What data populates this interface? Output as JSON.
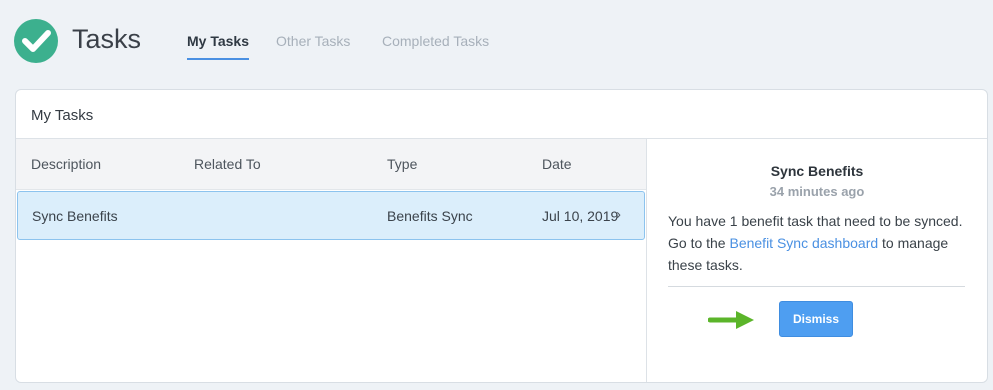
{
  "app": {
    "title": "Tasks",
    "logo_icon": "check-circle-icon",
    "accent": "#3cb08e"
  },
  "tabs": [
    {
      "label": "My Tasks",
      "active": true
    },
    {
      "label": "Other Tasks",
      "active": false
    },
    {
      "label": "Completed Tasks",
      "active": false
    }
  ],
  "panel": {
    "title": "My Tasks",
    "columns": [
      "Description",
      "Related To",
      "Type",
      "Date"
    ],
    "rows": [
      {
        "description": "Sync Benefits",
        "related_to": "",
        "type": "Benefits Sync",
        "date": "Jul 10, 2019",
        "selected": true
      }
    ]
  },
  "detail": {
    "title": "Sync Benefits",
    "time": "34 minutes ago",
    "message_before": "You have 1 benefit task that need to be synced. Go to the ",
    "link_text": "Benefit Sync dashboard",
    "message_after": " to manage these tasks.",
    "dismiss_label": "Dismiss",
    "arrow_color": "#5bb52a"
  }
}
